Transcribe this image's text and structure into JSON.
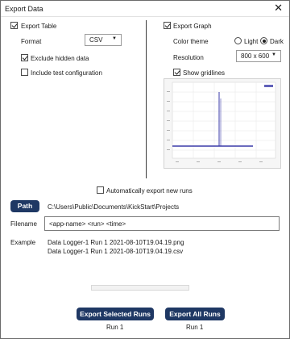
{
  "window": {
    "title": "Export Data",
    "close_glyph": "✕"
  },
  "export_table": {
    "label": "Export Table",
    "checked": true,
    "format_label": "Format",
    "format_value": "CSV",
    "exclude_hidden": {
      "label": "Exclude hidden data",
      "checked": true
    },
    "include_test": {
      "label": "Include test configuration",
      "checked": false
    }
  },
  "export_graph": {
    "label": "Export Graph",
    "checked": true,
    "color_theme_label": "Color theme",
    "theme_options": [
      {
        "label": "Light",
        "selected": false
      },
      {
        "label": "Dark",
        "selected": true
      }
    ],
    "resolution_label": "Resolution",
    "resolution_value": "800 x 600",
    "show_gridlines": {
      "label": "Show gridlines",
      "checked": true
    }
  },
  "auto_export": {
    "label": "Automatically export new runs",
    "checked": false
  },
  "path": {
    "button_label": "Path",
    "value": "C:\\Users\\Public\\Documents\\KickStart\\Projects"
  },
  "filename": {
    "label": "Filename",
    "value": "<app-name> <run> <time>"
  },
  "example": {
    "label": "Example",
    "lines": [
      "Data Logger-1 Run 1 2021-08-10T19.04.19.png",
      "Data Logger-1 Run 1 2021-08-10T19.04.19.csv"
    ]
  },
  "progress": 0,
  "actions": {
    "export_selected": {
      "label": "Export Selected Runs",
      "caption": "Run 1"
    },
    "export_all": {
      "label": "Export All Runs",
      "caption": "Run 1"
    }
  },
  "colors": {
    "button": "#1f3864",
    "series": "#3a3aa8"
  },
  "icons": [
    "close-icon",
    "chevron-down-icon",
    "checkbox-icon",
    "radio-icon"
  ]
}
